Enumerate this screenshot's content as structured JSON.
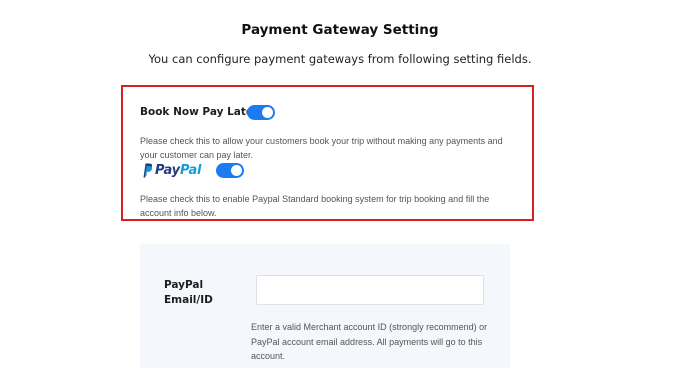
{
  "header": {
    "title": "Payment Gateway Setting",
    "subtitle": "You can configure payment gateways from following setting fields."
  },
  "book_now_pay_later": {
    "label": "Book Now Pay Later",
    "enabled": true,
    "description": "Please check this to allow your customers book your trip without making any payments and your customer can pay later."
  },
  "paypal": {
    "logo_text_pay": "Pay",
    "logo_text_pal": "Pal",
    "enabled": true,
    "description": "Please check this to enable Paypal Standard booking system for trip booking and fill the account info below."
  },
  "paypal_settings": {
    "email_label": "PayPal Email/ID",
    "email_value": "",
    "email_placeholder": "",
    "help_text": "Enter a valid Merchant account ID (strongly recommend) or PayPal account email address. All payments will go to this account."
  },
  "colors": {
    "toggle_on": "#1d7bf2",
    "highlight_border": "#d9201f",
    "paypal_dark": "#253b80",
    "paypal_light": "#179bd7",
    "panel_bg": "#f4f7fb"
  },
  "icons": {
    "paypal_logo": "paypal-logo-icon"
  }
}
